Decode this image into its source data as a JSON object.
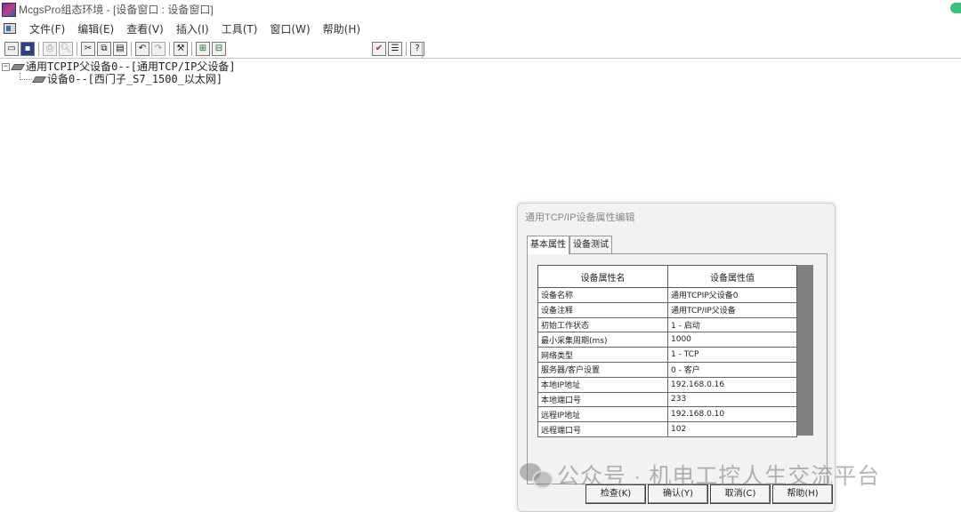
{
  "window": {
    "title": "McgsPro组态环境 - [设备窗口 : 设备窗口]"
  },
  "menu": {
    "items": [
      "文件(F)",
      "编辑(E)",
      "查看(V)",
      "插入(I)",
      "工具(T)",
      "窗口(W)",
      "帮助(H)"
    ]
  },
  "tree": {
    "root_label": "通用TCPIP父设备0--[通用TCP/IP父设备]",
    "child_label": "设备0--[西门子_S7_1500_以太网]"
  },
  "dialog": {
    "title": "通用TCP/IP设备属性编辑",
    "tabs": [
      "基本属性",
      "设备测试"
    ],
    "columns": [
      "设备属性名",
      "设备属性值"
    ],
    "rows": [
      [
        "设备名称",
        "通用TCPIP父设备0"
      ],
      [
        "设备注释",
        "通用TCP/IP父设备"
      ],
      [
        "初始工作状态",
        "1 - 启动"
      ],
      [
        "最小采集周期(ms)",
        "1000"
      ],
      [
        "网络类型",
        "1 - TCP"
      ],
      [
        "服务器/客户设置",
        "0 - 客户"
      ],
      [
        "本地IP地址",
        "192.168.0.16"
      ],
      [
        "本地端口号",
        "233"
      ],
      [
        "远程IP地址",
        "192.168.0.10"
      ],
      [
        "远程端口号",
        "102"
      ]
    ],
    "buttons": {
      "check": "检查(K)",
      "ok": "确认(Y)",
      "cancel": "取消(C)",
      "help": "帮助(H)"
    }
  },
  "watermark": {
    "text": "公众号 · 机电工控人生交流平台"
  }
}
